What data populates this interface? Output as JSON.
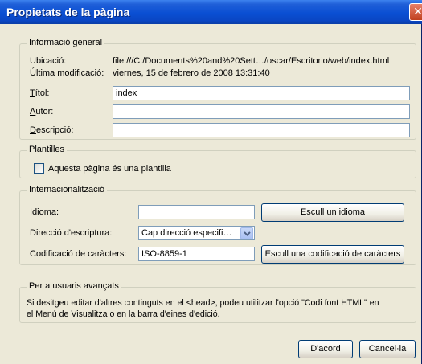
{
  "window": {
    "title": "Propietats de la pàgina",
    "close_glyph": "✕"
  },
  "general": {
    "legend": "Informació general",
    "location_label": "Ubicació:",
    "location_value": "file:///C:/Documents%20and%20Sett…/oscar/Escritorio/web/index.html",
    "modified_label": "Última modificació:",
    "modified_value": "viernes, 15 de febrero de 2008 13:31:40",
    "title_label_u": "T",
    "title_label_rest": "ítol:",
    "title_value": "index",
    "author_label_u": "A",
    "author_label_rest": "utor:",
    "author_value": "",
    "description_label_u": "D",
    "description_label_rest": "escripció:",
    "description_value": ""
  },
  "templates": {
    "legend": "Plantilles",
    "checkbox_label": "Aquesta pàgina és una plantilla",
    "checked": false
  },
  "i18n": {
    "legend": "Internacionalització",
    "language_label": "Idioma:",
    "language_value": "",
    "language_button": "Escull un idioma",
    "direction_label": "Direcció d'escriptura:",
    "direction_value": "Cap direcció especifi…",
    "encoding_label": "Codificació de caràcters:",
    "encoding_value": "ISO-8859-1",
    "encoding_button": "Escull una codificació de caràcters"
  },
  "advanced": {
    "legend": "Per a usuaris avançats",
    "text_line1": "Si desitgeu editar d'altres continguts en el <head>, podeu utilitzar l'opció \"Codi font HTML\" en",
    "text_line2": "el Menú de Visualitza o en la barra d'eines d'edició."
  },
  "buttons": {
    "ok": "D'acord",
    "cancel": "Cancel·la"
  },
  "colors": {
    "titlebar": "#0a4fd3",
    "dialog_bg": "#ece9d8",
    "close": "#c0401e"
  }
}
